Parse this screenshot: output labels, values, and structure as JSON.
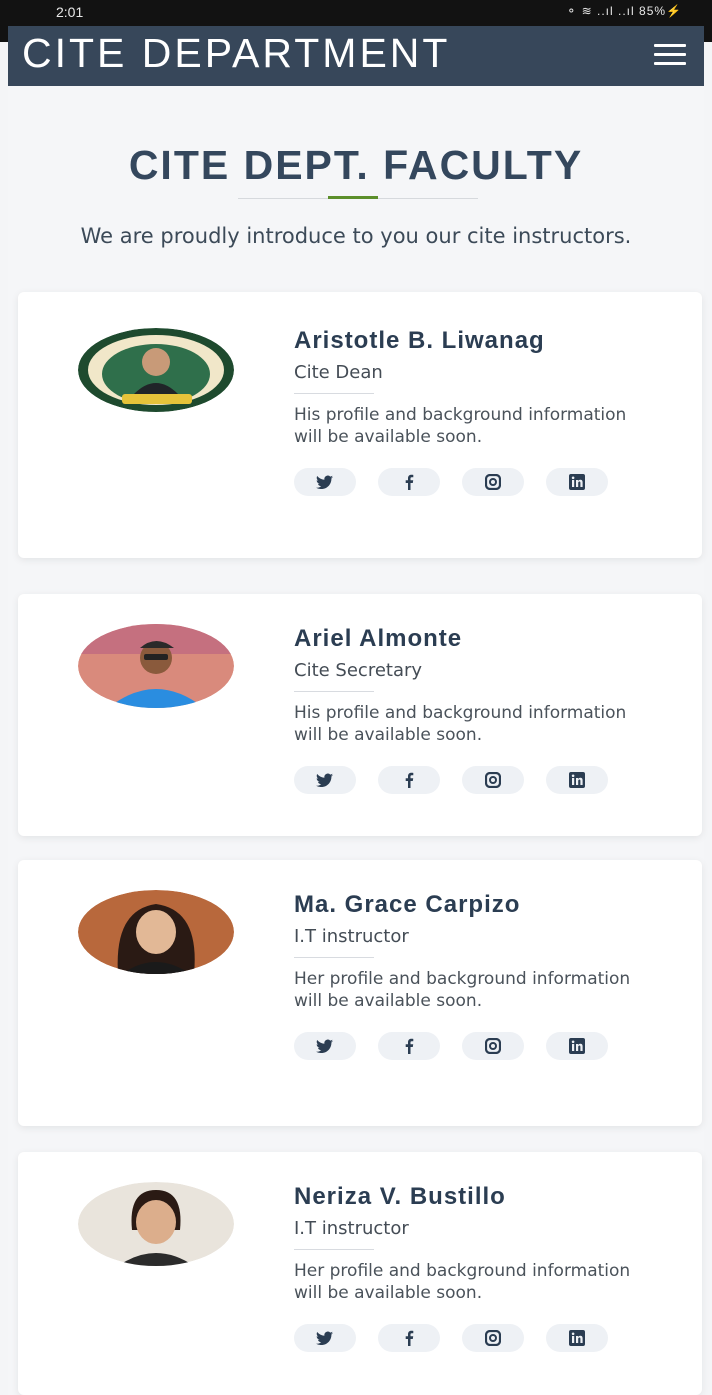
{
  "status_bar": {
    "time": "2:01",
    "battery": "85%"
  },
  "navbar": {
    "brand": "CITE DEPARTMENT",
    "menu_icon": "hamburger-icon"
  },
  "header": {
    "title": "CITE DEPT. FACULTY",
    "subtitle": "We are proudly introduce to you our cite instructors."
  },
  "faculty": [
    {
      "name": "Aristotle B. Liwanag",
      "role": "Cite Dean",
      "description": "His profile and background information will be available soon."
    },
    {
      "name": "Ariel Almonte",
      "role": "Cite Secretary",
      "description": "His profile and background information will be available soon."
    },
    {
      "name": "Ma. Grace Carpizo",
      "role": "I.T instructor",
      "description": "Her profile and background information will be available soon."
    },
    {
      "name": "Neriza V. Bustillo",
      "role": "I.T instructor",
      "description": "Her profile and background information will be available soon."
    }
  ],
  "social_icons": [
    "twitter-icon",
    "facebook-icon",
    "instagram-icon",
    "linkedin-icon"
  ],
  "colors": {
    "navbar": "#37475a",
    "accent": "#5c8f2b",
    "heading": "#34475d"
  }
}
